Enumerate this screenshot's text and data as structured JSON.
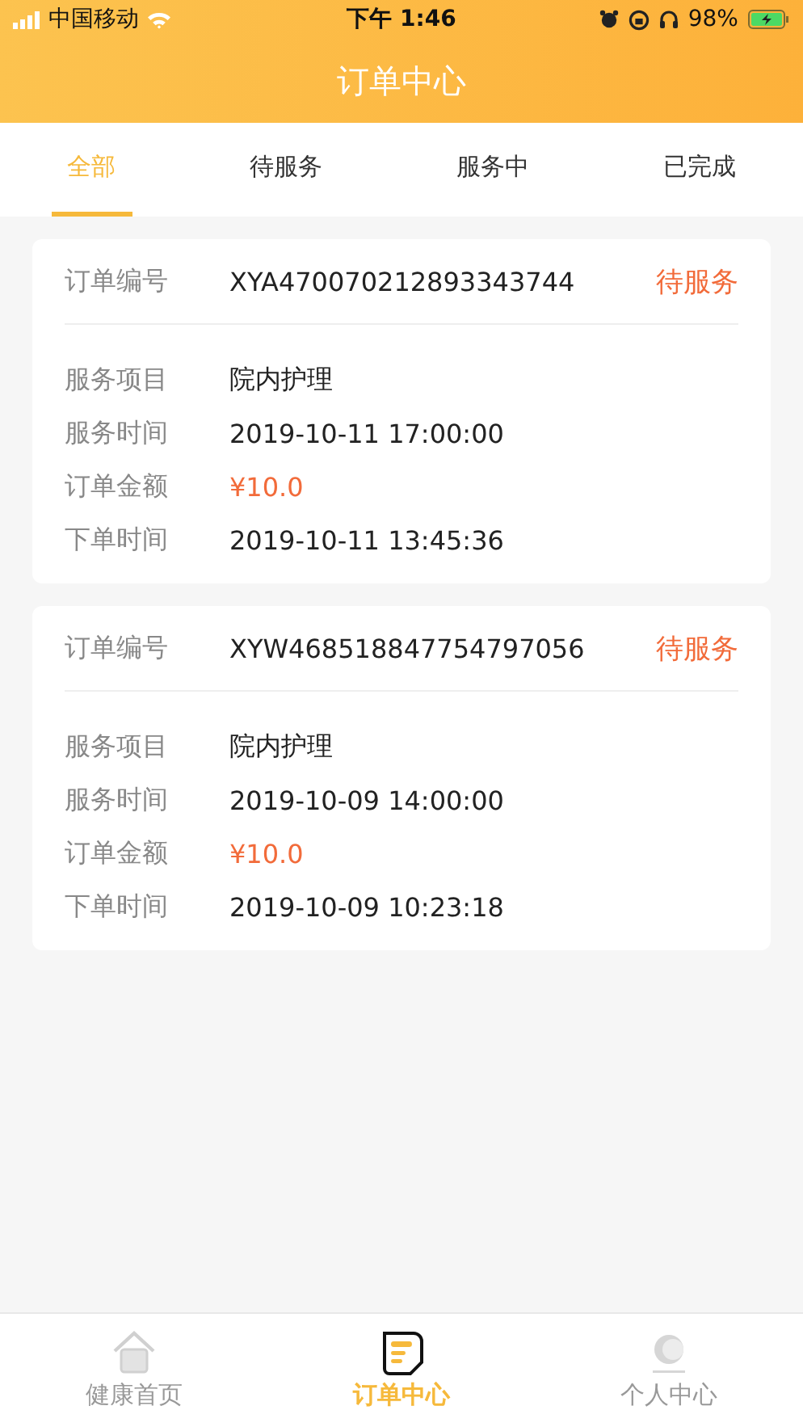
{
  "status_bar": {
    "carrier": "中国移动",
    "time": "下午 1:46",
    "battery": "98%"
  },
  "header": {
    "title": "订单中心"
  },
  "tabs": [
    {
      "label": "全部",
      "selected": true
    },
    {
      "label": "待服务",
      "selected": false
    },
    {
      "label": "服务中",
      "selected": false
    },
    {
      "label": "已完成",
      "selected": false
    }
  ],
  "orders": [
    {
      "number_label": "订单编号",
      "number": "XYA470070212893343744",
      "status": "待服务",
      "details": [
        {
          "label": "服务项目",
          "value": "院内护理",
          "kind": "text"
        },
        {
          "label": "服务时间",
          "value": "2019-10-11 17:00:00",
          "kind": "text"
        },
        {
          "label": "订单金额",
          "value": "¥10.0",
          "kind": "price"
        },
        {
          "label": "下单时间",
          "value": "2019-10-11 13:45:36",
          "kind": "text"
        }
      ]
    },
    {
      "number_label": "订单编号",
      "number": "XYW468518847754797056",
      "status": "待服务",
      "details": [
        {
          "label": "服务项目",
          "value": "院内护理",
          "kind": "text"
        },
        {
          "label": "服务时间",
          "value": "2019-10-09 14:00:00",
          "kind": "text"
        },
        {
          "label": "订单金额",
          "value": "¥10.0",
          "kind": "price"
        },
        {
          "label": "下单时间",
          "value": "2019-10-09 10:23:18",
          "kind": "text"
        }
      ]
    }
  ],
  "tab_bar": [
    {
      "label": "健康首页",
      "kind": "home",
      "selected": false
    },
    {
      "label": "订单中心",
      "kind": "orders",
      "selected": true
    },
    {
      "label": "个人中心",
      "kind": "profile",
      "selected": false
    }
  ]
}
